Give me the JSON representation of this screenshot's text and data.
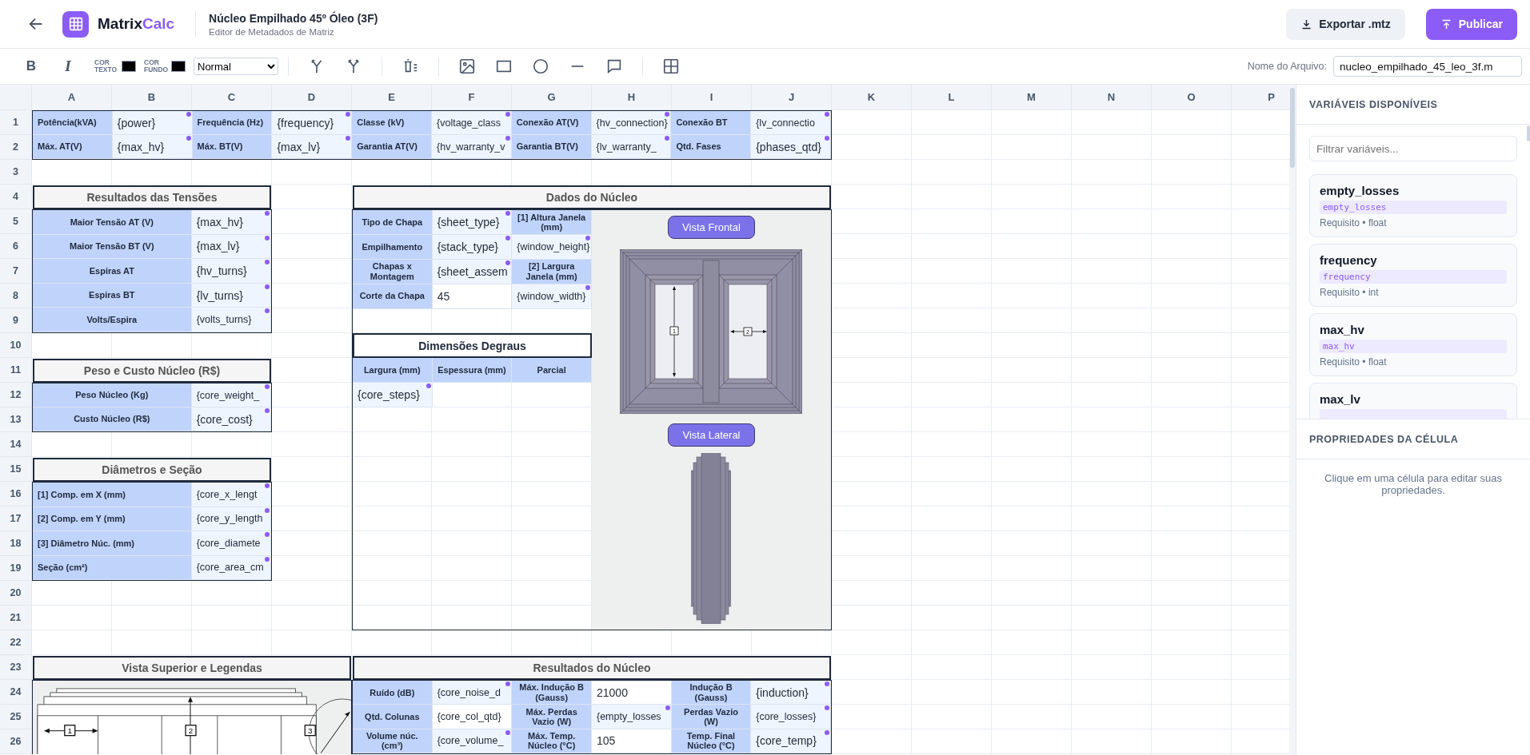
{
  "header": {
    "brand": {
      "text": "Matrix",
      "accent": "Calc"
    },
    "title": "Núcleo Empilhado 45º Óleo (3F)",
    "subtitle": "Editor de Metadados de Matriz",
    "buttons": [
      {
        "kind": "secondary",
        "label": "Exportar .mtz"
      },
      {
        "kind": "primary",
        "label": "Publicar"
      }
    ]
  },
  "toolbar": {
    "format_buttons": [
      {
        "kind": "bold",
        "label": "B"
      },
      {
        "kind": "italic",
        "label": "I"
      }
    ],
    "color_pickers": [
      {
        "label": "COR TEXTO",
        "color": "#000000"
      },
      {
        "label": "COR FUNDO",
        "color": "#000000"
      }
    ],
    "style_select": "Normal",
    "file_name": {
      "label": "Nome do Arquivo:",
      "value": "nucleo_empilhado_45_leo_3f.m"
    }
  },
  "sheet": {
    "columns": [
      "A",
      "B",
      "C",
      "D",
      "E",
      "F",
      "G",
      "H",
      "I",
      "J",
      "K",
      "L",
      "M",
      "N",
      "O",
      "P"
    ],
    "rows": [
      "1",
      "2",
      "3",
      "4",
      "5",
      "6",
      "7",
      "8",
      "9",
      "10",
      "11",
      "12",
      "13",
      "14",
      "15",
      "16",
      "17",
      "18",
      "19",
      "20",
      "21",
      "22",
      "23",
      "24",
      "25",
      "26"
    ],
    "blocks": [
      {
        "kind": "grid",
        "rows": [
          [
            {
              "kind": "label",
              "text": "Potência(kVA)"
            },
            {
              "kind": "value",
              "text": "{power}",
              "linked": true
            },
            {
              "kind": "label",
              "text": "Frequência (Hz)"
            },
            {
              "kind": "value",
              "text": "{frequency}",
              "linked": true
            },
            {
              "kind": "label",
              "text": "Classe (kV)"
            },
            {
              "kind": "value",
              "text": "{voltage_class",
              "linked": true
            },
            {
              "kind": "label",
              "text": "Conexão AT(V)"
            },
            {
              "kind": "value",
              "text": "{hv_connection}",
              "linked": true
            },
            {
              "kind": "label",
              "text": "Conexão BT"
            },
            {
              "kind": "value",
              "text": "{lv_connectio",
              "linked": true
            }
          ],
          [
            {
              "kind": "label",
              "text": "Máx. AT(V)"
            },
            {
              "kind": "value",
              "text": "{max_hv}",
              "linked": true
            },
            {
              "kind": "label",
              "text": "Máx. BT(V)"
            },
            {
              "kind": "value",
              "text": "{max_lv}",
              "linked": true
            },
            {
              "kind": "label",
              "text": "Garantia AT(V)"
            },
            {
              "kind": "value",
              "text": "{hv_warranty_v",
              "linked": true
            },
            {
              "kind": "label",
              "text": "Garantia BT(V)"
            },
            {
              "kind": "value",
              "text": "{lv_warranty_",
              "linked": true
            },
            {
              "kind": "label",
              "text": "Qtd. Fases"
            },
            {
              "kind": "value",
              "text": "{phases_qtd}",
              "linked": true
            }
          ]
        ]
      },
      {
        "kind": "table",
        "title": "Resultados das Tensões",
        "rows": [
          [
            {
              "kind": "label",
              "text": "Maior Tensão AT (V)"
            },
            {
              "kind": "value",
              "text": "{max_hv}",
              "linked": true
            }
          ],
          [
            {
              "kind": "label",
              "text": "Maior Tensão BT (V)"
            },
            {
              "kind": "value",
              "text": "{max_lv}",
              "linked": true
            }
          ],
          [
            {
              "kind": "label",
              "text": "Espiras AT"
            },
            {
              "kind": "value",
              "text": "{hv_turns}",
              "linked": true
            }
          ],
          [
            {
              "kind": "label",
              "text": "Espiras BT"
            },
            {
              "kind": "value",
              "text": "{lv_turns}",
              "linked": true
            }
          ],
          [
            {
              "kind": "label",
              "text": "Volts/Espira"
            },
            {
              "kind": "value",
              "text": "{volts_turns}",
              "linked": true
            }
          ]
        ]
      },
      {
        "kind": "table",
        "title": "Peso e Custo Núcleo (R$)",
        "rows": [
          [
            {
              "kind": "label",
              "text": "Peso Núcleo (Kg)"
            },
            {
              "kind": "value",
              "text": "{core_weight_",
              "linked": true
            }
          ],
          [
            {
              "kind": "label",
              "text": "Custo Núcleo (R$)"
            },
            {
              "kind": "value",
              "text": "{core_cost}",
              "linked": true
            }
          ]
        ]
      },
      {
        "kind": "table",
        "title": "Diâmetros e Seção",
        "rows": [
          [
            {
              "kind": "label",
              "text": "[1] Comp. em X (mm)"
            },
            {
              "kind": "value",
              "text": "{core_x_lengt",
              "linked": true
            }
          ],
          [
            {
              "kind": "label",
              "text": "[2] Comp. em Y (mm)"
            },
            {
              "kind": "value",
              "text": "{core_y_length",
              "linked": true
            }
          ],
          [
            {
              "kind": "label",
              "text": "[3] Diâmetro Núc. (mm)"
            },
            {
              "kind": "value",
              "text": "{core_diamete",
              "linked": true
            }
          ],
          [
            {
              "kind": "label",
              "text": "Seção (cm²)"
            },
            {
              "kind": "value",
              "text": "{core_area_cm",
              "linked": true
            }
          ]
        ]
      },
      {
        "kind": "core_data",
        "title": "Dados do Núcleo",
        "rows": [
          [
            {
              "kind": "label",
              "text": "Tipo de Chapa"
            },
            {
              "kind": "value",
              "text": "{sheet_type}",
              "linked": true
            },
            {
              "kind": "label",
              "text": "[1] Altura Janela (mm)"
            }
          ],
          [
            {
              "kind": "label",
              "text": "Empilhamento"
            },
            {
              "kind": "value",
              "text": "{stack_type}",
              "linked": true
            },
            {
              "kind": "value",
              "text": "{window_height}",
              "linked": true
            }
          ],
          [
            {
              "kind": "label",
              "text": "Chapas x Montagem"
            },
            {
              "kind": "value",
              "text": "{sheet_assem",
              "linked": true
            },
            {
              "kind": "label",
              "text": "[2] Largura Janela (mm)"
            }
          ],
          [
            {
              "kind": "label",
              "text": "Corte da Chapa"
            },
            {
              "kind": "value",
              "text": "45",
              "linked": false
            },
            {
              "kind": "value",
              "text": "{window_width}",
              "linked": true
            }
          ]
        ],
        "steps": {
          "title": "Dimensões Degraus",
          "columns": [
            "Largura (mm)",
            "Espessura (mm)",
            "Parcial"
          ],
          "rows": [
            [
              {
                "kind": "value",
                "text": "{core_steps}",
                "linked": true
              }
            ]
          ]
        },
        "views": [
          {
            "kind": "front",
            "label": "Vista Frontal",
            "markers": [
              "1",
              "2"
            ]
          },
          {
            "kind": "side",
            "label": "Vista Lateral"
          }
        ]
      },
      {
        "kind": "drawing",
        "title": "Vista Superior e Legendas",
        "markers": [
          "1",
          "2",
          "3"
        ]
      },
      {
        "kind": "table",
        "title": "Resultados do Núcleo",
        "rows": [
          [
            {
              "kind": "label",
              "text": "Ruído (dB)"
            },
            {
              "kind": "value",
              "text": "{core_noise_d",
              "linked": true
            },
            {
              "kind": "label",
              "text": "Máx. Indução B (Gauss)"
            },
            {
              "kind": "value",
              "text": "21000",
              "linked": false
            },
            {
              "kind": "label",
              "text": "Indução B (Gauss)"
            },
            {
              "kind": "value",
              "text": "{induction}",
              "linked": true
            }
          ],
          [
            {
              "kind": "label",
              "text": "Qtd. Colunas"
            },
            {
              "kind": "value",
              "text": "{core_col_qtd}",
              "linked": false
            },
            {
              "kind": "label",
              "text": "Máx. Perdas Vazio (W)"
            },
            {
              "kind": "value",
              "text": "{empty_losses",
              "linked": true
            },
            {
              "kind": "label",
              "text": "Perdas Vazio (W)"
            },
            {
              "kind": "value",
              "text": "{core_losses}",
              "linked": true
            }
          ],
          [
            {
              "kind": "label",
              "text": "Volume núc. (cm³)"
            },
            {
              "kind": "value",
              "text": "{core_volume_",
              "linked": true
            },
            {
              "kind": "label",
              "text": "Máx. Temp. Núcleo (°C)"
            },
            {
              "kind": "value",
              "text": "105",
              "linked": false
            },
            {
              "kind": "label",
              "text": "Temp. Final Núcleo (°C)"
            },
            {
              "kind": "value",
              "text": "{core_temp}",
              "linked": true
            }
          ]
        ]
      }
    ]
  },
  "sidebar": {
    "variables": {
      "title": "VARIÁVEIS DISPONÍVEIS",
      "filter_placeholder": "Filtrar variáveis...",
      "items": [
        {
          "name": "empty_losses",
          "code": "empty_losses",
          "meta": "Requisito • float"
        },
        {
          "name": "frequency",
          "code": "frequency",
          "meta": "Requisito • int"
        },
        {
          "name": "max_hv",
          "code": "max_hv",
          "meta": "Requisito • float"
        },
        {
          "name": "max_lv"
        }
      ]
    },
    "properties": {
      "title": "PROPRIEDADES DA CÉLULA",
      "empty_text": "Clique em uma célula para editar suas propriedades."
    }
  }
}
